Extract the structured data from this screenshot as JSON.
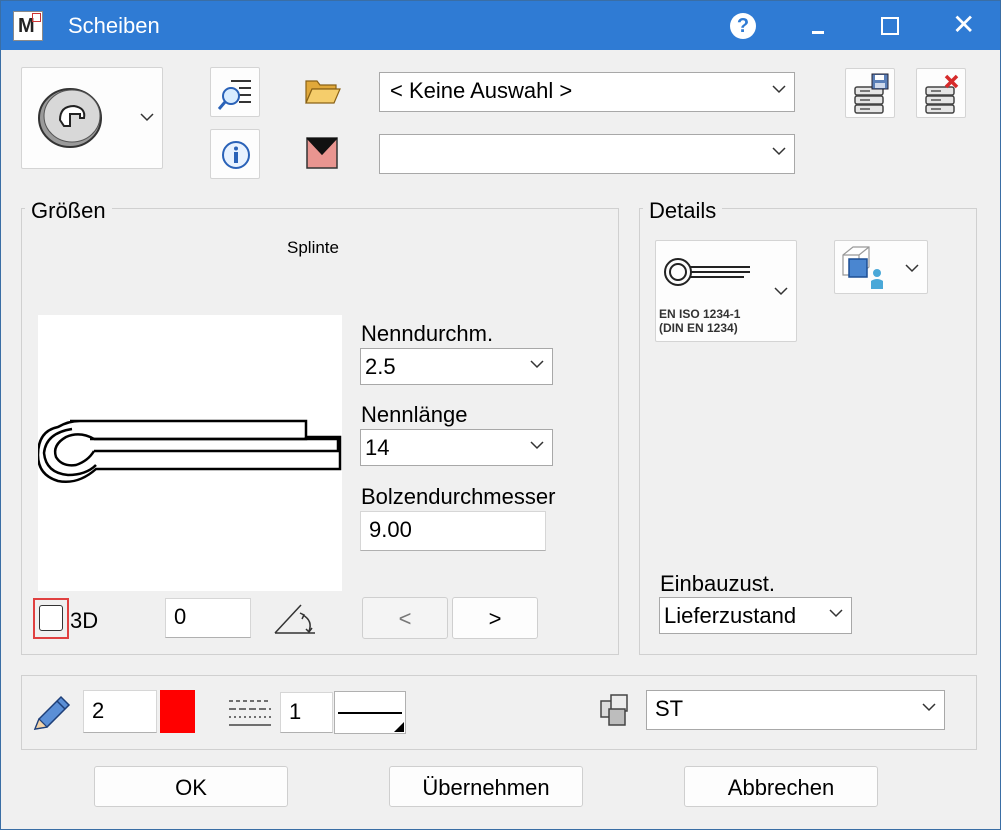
{
  "window": {
    "title": "Scheiben",
    "app_icon_letter": "M"
  },
  "toolbar": {
    "selection_combo_value": "< Keine Auswahl >",
    "second_combo_value": ""
  },
  "groessen": {
    "group_label": "Größen",
    "preview_caption": "Splinte",
    "nenndurchm_label": "Nenndurchm.",
    "nenndurchm_value": "2.5",
    "nennlaenge_label": "Nennlänge",
    "nennlaenge_value": "14",
    "bolzen_label": "Bolzendurchmesser",
    "bolzen_value": "9.00",
    "checkbox_3d_label": "3D",
    "checkbox_3d_checked": false,
    "angle_value": "0",
    "prev_label": "<",
    "next_label": ">"
  },
  "details": {
    "group_label": "Details",
    "standard_line1": "EN ISO 1234-1",
    "standard_line2": "(DIN EN 1234)",
    "einbau_label": "Einbauzust.",
    "einbau_value": "Lieferzustand"
  },
  "bottom": {
    "pen_value": "2",
    "pen_color": "#ff0000",
    "line_value": "1",
    "material_value": "ST"
  },
  "buttons": {
    "ok": "OK",
    "apply": "Übernehmen",
    "cancel": "Abbrechen"
  },
  "icons": {
    "washer": "washer-icon",
    "filter_list": "filter-list-icon",
    "info": "info-icon",
    "folder": "folder-open-icon",
    "envelope": "envelope-icon",
    "save_db": "database-save-icon",
    "delete_db": "database-delete-icon",
    "view3d": "view-3d-icon",
    "angle": "angle-icon",
    "pen": "pen-icon",
    "line_style": "line-style-icon",
    "layers": "layers-icon"
  },
  "colors": {
    "titlebar": "#2f7bd4",
    "accent_red": "#ff0000",
    "highlight_border": "#e04040"
  }
}
